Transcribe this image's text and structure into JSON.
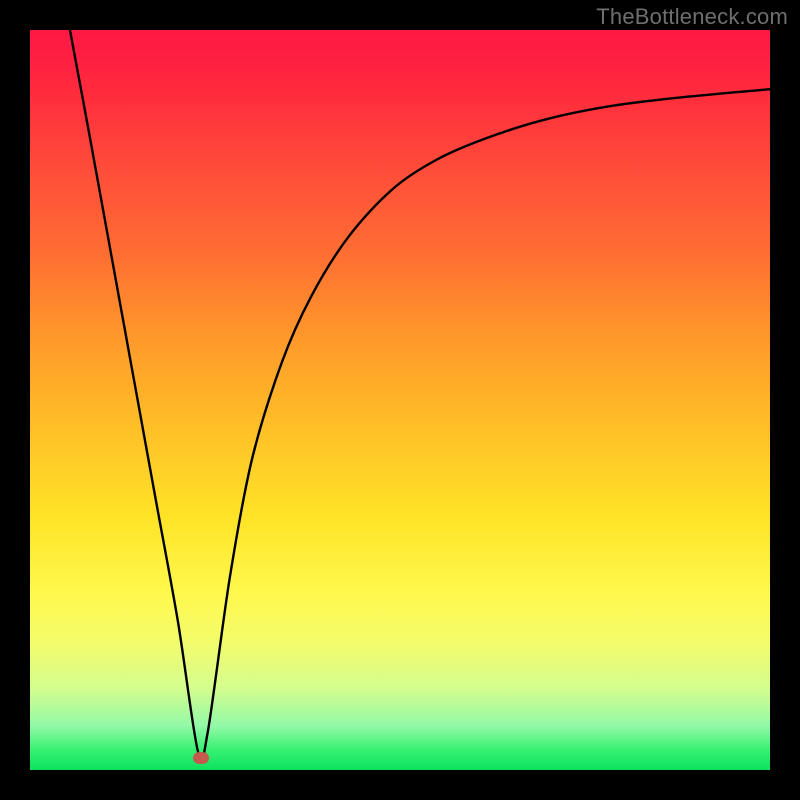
{
  "watermark": "TheBottleneck.com",
  "chart_data": {
    "type": "line",
    "title": "",
    "xlabel": "",
    "ylabel": "",
    "xlim": [
      0,
      100
    ],
    "ylim": [
      0,
      100
    ],
    "note": "No axes or tick labels are rendered in the image; values are estimated from pixel position within the gradient plot area (origin at bottom-left).",
    "series": [
      {
        "name": "bottleneck-curve",
        "x": [
          5.4,
          8,
          11,
          14,
          17,
          20,
          22.7,
          24,
          27,
          30,
          34,
          38,
          43,
          49,
          55,
          62,
          70,
          79,
          89,
          100
        ],
        "y": [
          100,
          86,
          69.5,
          53,
          36.5,
          20,
          2.5,
          5,
          26,
          42,
          55,
          64,
          72,
          78.5,
          82.5,
          85.5,
          88,
          89.8,
          91,
          92
        ]
      }
    ],
    "marker": {
      "x": 23.1,
      "y": 1.6,
      "color": "#c45a4d"
    },
    "background_gradient": {
      "direction": "top-to-bottom",
      "stops": [
        {
          "pos": 0.0,
          "color": "#ff1744"
        },
        {
          "pos": 0.5,
          "color": "#ffcc27"
        },
        {
          "pos": 0.82,
          "color": "#f6fd60"
        },
        {
          "pos": 1.0,
          "color": "#0be25e"
        }
      ]
    },
    "frame_color": "#000000"
  }
}
